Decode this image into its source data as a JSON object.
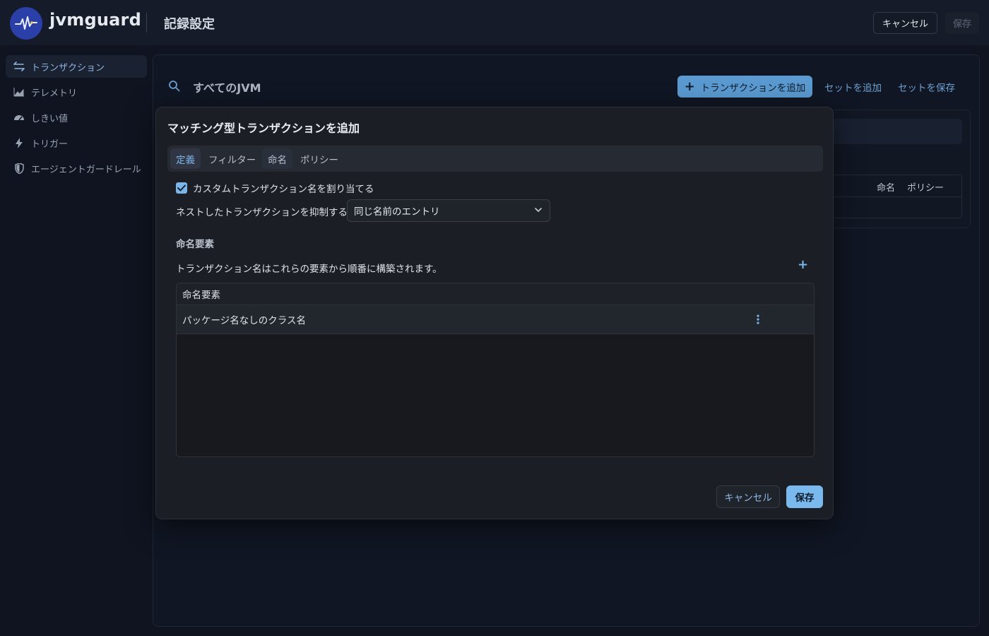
{
  "header": {
    "brand": "jvmguard",
    "title": "記録設定",
    "cancel_label": "キャンセル",
    "save_label": "保存"
  },
  "sidebar": {
    "items": [
      {
        "label": "トランザクション",
        "icon": "transaction-arrows-icon",
        "active": true
      },
      {
        "label": "テレメトリ",
        "icon": "area-chart-icon",
        "active": false
      },
      {
        "label": "しきい値",
        "icon": "gauge-icon",
        "active": false
      },
      {
        "label": "トリガー",
        "icon": "lightning-icon",
        "active": false
      },
      {
        "label": "エージェントガードレール",
        "icon": "shield-icon",
        "active": false
      }
    ]
  },
  "main": {
    "scope": "すべてのJVM",
    "add_transaction_label": "トランザクションを追加",
    "add_set_label": "セットを追加",
    "save_set_label": "セットを保存",
    "table_columns": [
      "命名",
      "ポリシー"
    ]
  },
  "modal": {
    "title": "マッチング型トランザクションを追加",
    "tabs": [
      "定義",
      "フィルター",
      "命名",
      "ポリシー"
    ],
    "active_tab": "定義",
    "custom_name_checkbox": {
      "label": "カスタムトランザクション名を割り当てる",
      "checked": true
    },
    "suppress_label": "ネストしたトランザクションを抑制する",
    "suppress_value": "同じ名前のエントリ",
    "naming_section_title": "命名要素",
    "naming_description": "トランザクション名はこれらの要素から順番に構築されます。",
    "naming_table": {
      "header": "命名要素",
      "rows": [
        "パッケージ名なしのクラス名"
      ]
    },
    "cancel_label": "キャンセル",
    "save_label": "保存"
  },
  "colors": {
    "accent": "#7ab9ee",
    "primary_button": "#5a9ad0",
    "background": "#0f1420"
  }
}
